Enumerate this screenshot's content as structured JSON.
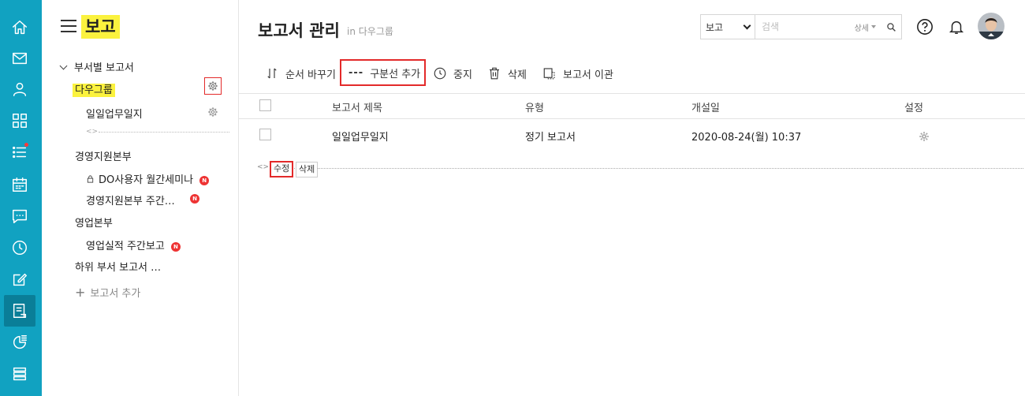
{
  "sidebar": {
    "title": "보고",
    "tree": {
      "group_label": "부서별 보고서",
      "items": [
        {
          "label": "다우그룹"
        },
        {
          "label": "일일업무일지"
        },
        {
          "label": "경영지원본부"
        },
        {
          "label": "DO사용자 월간세미나",
          "badge": "N"
        },
        {
          "label": "경영지원본부 주간…",
          "badge": "N"
        },
        {
          "label": "영업본부"
        },
        {
          "label": "영업실적 주간보고",
          "badge": "N"
        },
        {
          "label": "하위 부서 보고서 …"
        }
      ],
      "add_label": "보고서 추가"
    }
  },
  "header": {
    "title": "보고서 관리",
    "subtitle": "in 다우그룹",
    "search": {
      "scope": "보고",
      "placeholder": "검색",
      "detail_label": "상세"
    }
  },
  "toolbar": {
    "reorder": "순서 바꾸기",
    "add_divider": "구분선 추가",
    "stop": "중지",
    "delete": "삭제",
    "transfer": "보고서 이관"
  },
  "table": {
    "headers": [
      "보고서 제목",
      "유형",
      "개설일",
      "설정"
    ],
    "rows": [
      {
        "title": "일일업무일지",
        "type": "정기 보고서",
        "created": "2020-08-24(월) 10:37"
      }
    ],
    "divider_actions": {
      "edit": "수정",
      "delete": "삭제"
    }
  },
  "colors": {
    "rail": "#11a2c1",
    "rail_active": "#0a7e98",
    "highlight": "#fbf23e",
    "emphasis_box": "#e32a2a",
    "badge": "#ee3333"
  }
}
